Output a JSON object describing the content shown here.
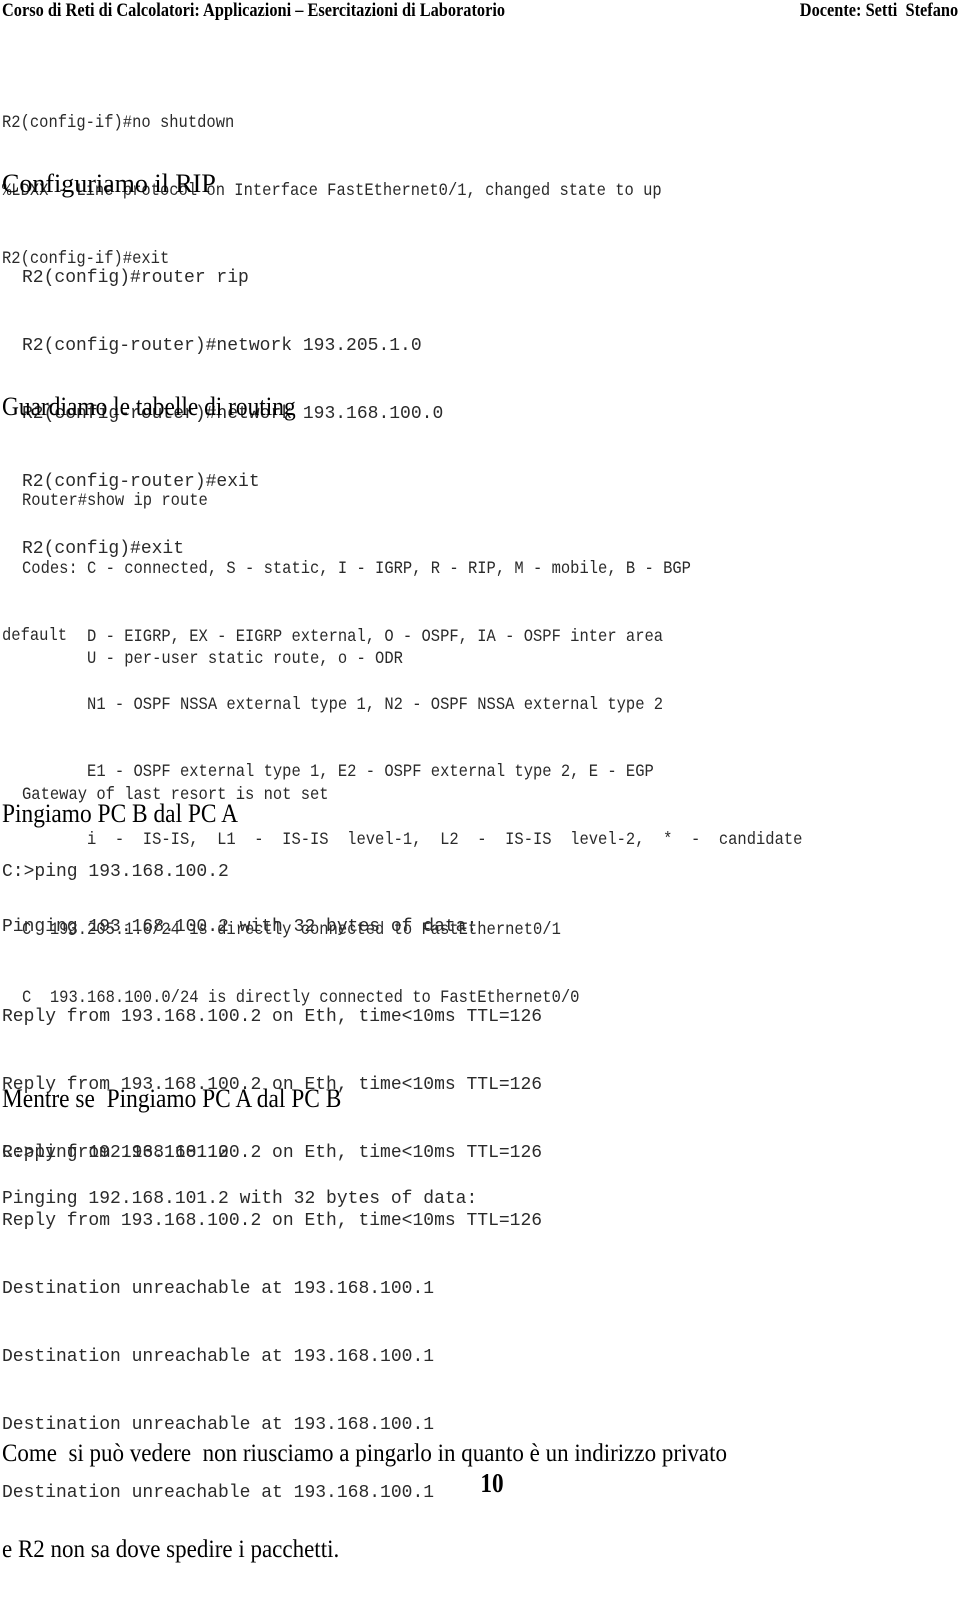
{
  "header": {
    "course_title": "Corso di Reti di Calcolatori: Applicazioni – Esercitazioni di Laboratorio",
    "teacher": "Docente: Setti  Stefano"
  },
  "intro_console": [
    "R2(config-if)#no shutdown",
    "%LDXX - Line protocol on Interface FastEthernet0/1, changed state to up",
    "R2(config-if)#exit"
  ],
  "sections": {
    "rip": {
      "heading": "Configuriamo il RIP",
      "console": [
        "R2(config)#router rip",
        "R2(config-router)#network 193.205.1.0",
        "R2(config-router)#network 193.168.100.0",
        "R2(config-router)#exit",
        "R2(config)#exit"
      ]
    },
    "routing": {
      "heading": "Guardiamo le tabelle di routing",
      "console": [
        "Router#show ip route",
        "Codes: C - connected, S - static, I - IGRP, R - RIP, M - mobile, B - BGP",
        "       D - EIGRP, EX - EIGRP external, O - OSPF, IA - OSPF inter area",
        "       N1 - OSPF NSSA external type 1, N2 - OSPF NSSA external type 2",
        "       E1 - OSPF external type 1, E2 - OSPF external type 2, E - EGP",
        "       i  -  IS-IS,  L1  -  IS-IS  level-1,  L2  -  IS-IS  level-2,  *  -  candidate"
      ],
      "console_wrap": "default",
      "console_tail": [
        "       U - per-user static route, o - ODR",
        "",
        "Gateway of last resort is not set",
        "",
        "C  193.205.1.0/24 is directly connected to FastEthernet0/1",
        "C  193.168.100.0/24 is directly connected to FastEthernet0/0"
      ]
    },
    "ping_b": {
      "heading": "Pingiamo PC B dal PC A",
      "command": "C:>ping 193.168.100.2",
      "pinging": "Pinging 193.168.100.2 with 32 bytes of data:",
      "replies": [
        "Reply from 193.168.100.2 on Eth, time<10ms TTL=126",
        "Reply from 193.168.100.2 on Eth, time<10ms TTL=126",
        "Reply from 193.168.100.2 on Eth, time<10ms TTL=126",
        "Reply from 193.168.100.2 on Eth, time<10ms TTL=126"
      ]
    },
    "ping_a": {
      "heading": "Mentre se  Pingiamo PC A dal PC B",
      "command": "C:>ping 192.168.101.2",
      "pinging": "Pinging 192.168.101.2 with 32 bytes of data:",
      "replies": [
        "Destination unreachable at 193.168.100.1",
        "Destination unreachable at 193.168.100.1",
        "Destination unreachable at 193.168.100.1",
        "Destination unreachable at 193.168.100.1"
      ]
    }
  },
  "conclusion": [
    "Come  si può vedere  non riusciamo a pingarlo in quanto è un indirizzo privato",
    "e R2 non sa dove spedire i pacchetti."
  ],
  "page_number": "10"
}
